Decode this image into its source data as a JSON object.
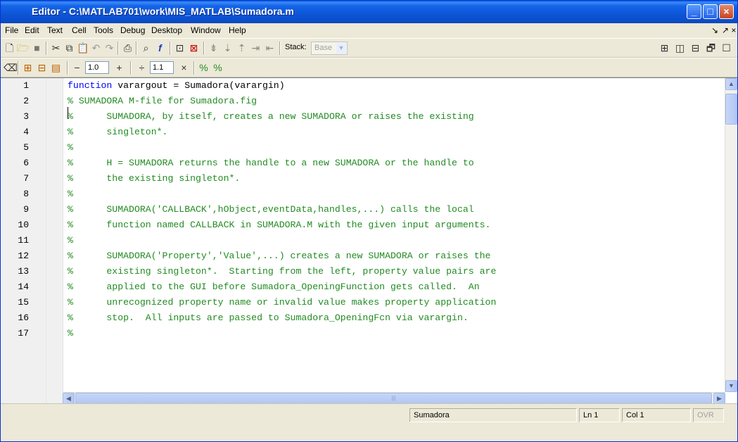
{
  "window": {
    "title": "Editor - C:\\MATLAB701\\work\\MIS_MATLAB\\Sumadora.m",
    "minimize": "_",
    "maximize": "□",
    "close": "×"
  },
  "menu": [
    "File",
    "Edit",
    "Text",
    "Cell",
    "Tools",
    "Debug",
    "Desktop",
    "Window",
    "Help"
  ],
  "menu_right": {
    "dock": "↘",
    "undock": "↗ ×"
  },
  "toolbar": {
    "stack_label": "Stack:",
    "stack_value": "Base"
  },
  "cell_toolbar": {
    "minus": "−",
    "increment_value": "1.0",
    "plus": "+",
    "divide": "÷",
    "divide_value": "1.1",
    "times": "×"
  },
  "editor": {
    "line_numbers": [
      "1",
      "2",
      "3",
      "4",
      "5",
      "6",
      "7",
      "8",
      "9",
      "10",
      "11",
      "12",
      "13",
      "14",
      "15",
      "16",
      "17"
    ],
    "lines": [
      {
        "kw": "function",
        "rest": " varargout = Sumadora(varargin)"
      },
      {
        "comment": "% SUMADORA M-file for Sumadora.fig"
      },
      {
        "comment": "%      SUMADORA, by itself, creates a new SUMADORA or raises the existing"
      },
      {
        "comment": "%      singleton*."
      },
      {
        "comment": "%"
      },
      {
        "comment": "%      H = SUMADORA returns the handle to a new SUMADORA or the handle to"
      },
      {
        "comment": "%      the existing singleton*."
      },
      {
        "comment": "%"
      },
      {
        "comment": "%      SUMADORA('CALLBACK',hObject,eventData,handles,...) calls the local"
      },
      {
        "comment": "%      function named CALLBACK in SUMADORA.M with the given input arguments."
      },
      {
        "comment": "%"
      },
      {
        "comment": "%      SUMADORA('Property','Value',...) creates a new SUMADORA or raises the"
      },
      {
        "comment": "%      existing singleton*.  Starting from the left, property value pairs are"
      },
      {
        "comment": "%      applied to the GUI before Sumadora_OpeningFunction gets called.  An"
      },
      {
        "comment": "%      unrecognized property name or invalid value makes property application"
      },
      {
        "comment": "%      stop.  All inputs are passed to Sumadora_OpeningFcn via varargin."
      },
      {
        "comment": "%"
      }
    ]
  },
  "status": {
    "function_name": "Sumadora",
    "ln": "Ln  1",
    "col": "Col  1",
    "ovr": "OVR"
  },
  "icons": [
    "new-file-icon",
    "open-folder-icon",
    "save-icon",
    "cut-icon",
    "copy-icon",
    "paste-icon",
    "undo-icon",
    "redo-icon",
    "print-icon",
    "find-icon",
    "function-icon",
    "set-breakpoint-icon",
    "clear-breakpoints-icon",
    "step-icon",
    "step-in-icon",
    "step-out-icon",
    "continue-icon",
    "exit-debug-icon",
    "tile-icon",
    "split-vertical-icon",
    "split-horizontal-icon",
    "float-icon",
    "maximize-pane-icon",
    "cell-mode-icon",
    "eval-cell-icon",
    "eval-cell-advance-icon",
    "eval-file-icon",
    "increment-comment-icon",
    "decrement-comment-icon"
  ]
}
